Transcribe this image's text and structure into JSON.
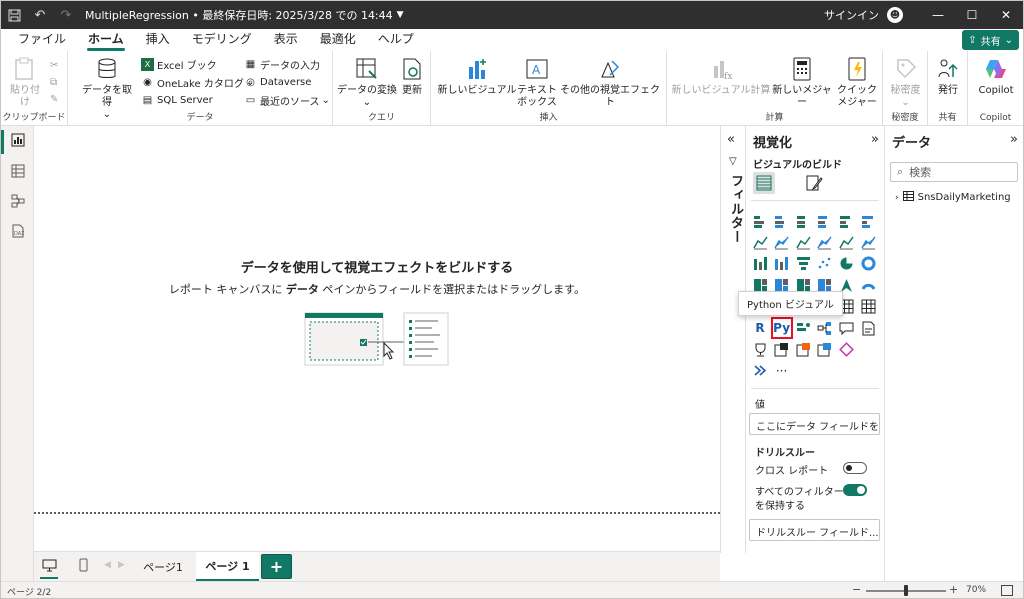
{
  "titlebar": {
    "title": "MultipleRegression • 最終保存日時: 2025/3/28 での 14:44",
    "signin": "サインイン"
  },
  "menu": {
    "items": [
      "ファイル",
      "ホーム",
      "挿入",
      "モデリング",
      "表示",
      "最適化",
      "ヘルプ"
    ],
    "active": "ホーム",
    "share": "共有"
  },
  "ribbon": {
    "clipboard": {
      "paste": "貼り付け",
      "label": "クリップボード"
    },
    "data": {
      "get_data": "データを取得",
      "excel": "Excel ブック",
      "onelake": "OneLake カタログ",
      "sql": "SQL Server",
      "enter_data": "データの入力",
      "dataverse": "Dataverse",
      "recent": "最近のソース",
      "label": "データ"
    },
    "query": {
      "transform": "データの変換",
      "refresh": "更新",
      "label": "クエリ"
    },
    "insert": {
      "new_visual": "新しいビジュアル",
      "textbox_1": "テキスト",
      "textbox_2": "ボックス",
      "more_visuals": "その他の視覚エフェクト",
      "label": "挿入"
    },
    "calc": {
      "new_visual_calc": "新しいビジュアル計算",
      "new_measure": "新しいメジャー",
      "quick_1": "クイック",
      "quick_2": "メジャー",
      "label": "計算"
    },
    "sensitivity": {
      "btn": "秘密度",
      "label": "秘密度"
    },
    "share": {
      "publish": "発行",
      "label": "共有"
    },
    "copilot": {
      "btn": "Copilot",
      "label": "Copilot"
    }
  },
  "canvas": {
    "empty_title": "データを使用して視覚エフェクトをビルドする",
    "empty_desc_1": "レポート キャンバスに ",
    "empty_desc_bold": "データ",
    "empty_desc_2": " ペインからフィールドを選択またはドラッグします。"
  },
  "filters": {
    "label": "フィルター"
  },
  "visualizations": {
    "title": "視覚化",
    "build_label": "ビジュアルのビルド",
    "tooltip": "Python ビジュアル",
    "py_label": "Py",
    "r_label": "R",
    "more": "···",
    "values_label": "値",
    "values_placeholder": "ここにデータ フィールドを...",
    "drillthrough_title": "ドリルスルー",
    "cross_report": "クロス レポート",
    "keep_filters_1": "すべてのフィルター",
    "keep_filters_2": "を保持する",
    "drill_field_placeholder": "ドリルスルー フィールド...",
    "cross_report_on": false,
    "keep_filters_on": true
  },
  "data_pane": {
    "title": "データ",
    "search_placeholder": "検索",
    "tables": [
      "SnsDailyMarketing"
    ]
  },
  "pages": {
    "tabs": [
      "ページ1",
      "ページ 1"
    ],
    "active_index": 1,
    "add": "+"
  },
  "status": {
    "page_info": "ページ 2/2",
    "zoom": "70%",
    "zoom_minus": "−",
    "zoom_plus": "+"
  },
  "colors": {
    "accent": "#117865",
    "highlight": "#e81123",
    "titlebar": "#2f2f2f"
  }
}
